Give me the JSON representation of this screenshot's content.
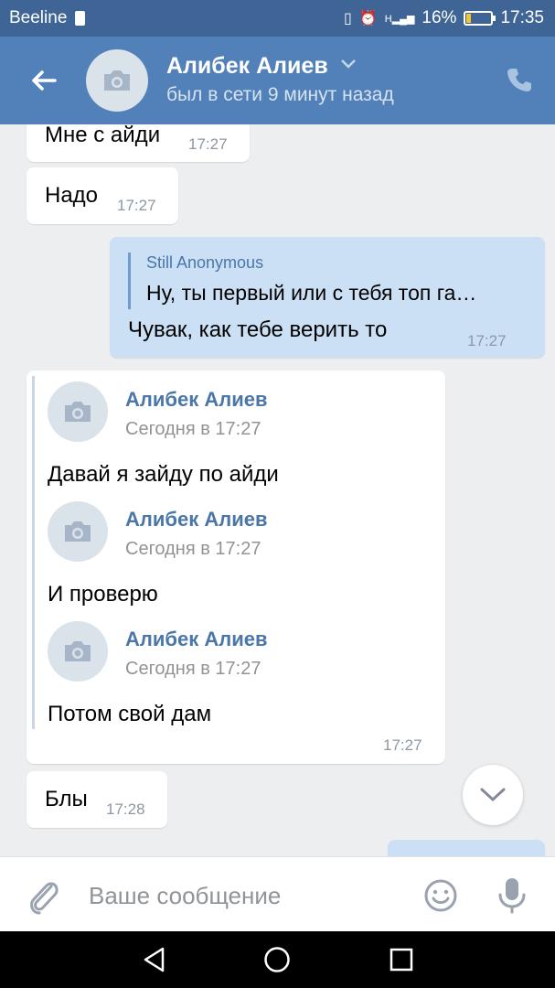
{
  "status_bar": {
    "carrier": "Beeline",
    "battery": "16%",
    "battery_level": 0.16,
    "time": "17:35",
    "network": "H"
  },
  "header": {
    "name": "Алибек Алиев",
    "status": "был в сети 9 минут назад"
  },
  "messages": [
    {
      "text": "Мне с айди",
      "time": "17:27"
    },
    {
      "text": "Надо",
      "time": "17:27"
    },
    {
      "reply_name": "Still Anonymous",
      "reply_text": "Ну, ты первый или с тебя топ га…",
      "text": "Чувак, как тебе верить то",
      "time": "17:27"
    },
    {
      "forwarded": [
        {
          "name": "Алибек Алиев",
          "date": "Сегодня в 17:27",
          "text": "Давай я зайду по айди"
        },
        {
          "name": "Алибек Алиев",
          "date": "Сегодня в 17:27",
          "text": "И проверю"
        },
        {
          "name": "Алибек Алиев",
          "date": "Сегодня в 17:27",
          "text": "Потом свой дам"
        }
      ],
      "time": "17:27"
    },
    {
      "text": "Блы",
      "time": "17:28"
    }
  ],
  "input": {
    "placeholder": "Ваше сообщение"
  },
  "colors": {
    "header": "#5181b8",
    "status_bar": "#3e6595",
    "outgoing": "#cce0f5",
    "background": "#edeef0",
    "link": "#4a76a8"
  },
  "icons": [
    "back-arrow-icon",
    "camera-icon",
    "chevron-down-icon",
    "phone-icon",
    "paperclip-icon",
    "smile-icon",
    "mic-icon",
    "nav-back-icon",
    "nav-home-icon",
    "nav-recents-icon"
  ]
}
